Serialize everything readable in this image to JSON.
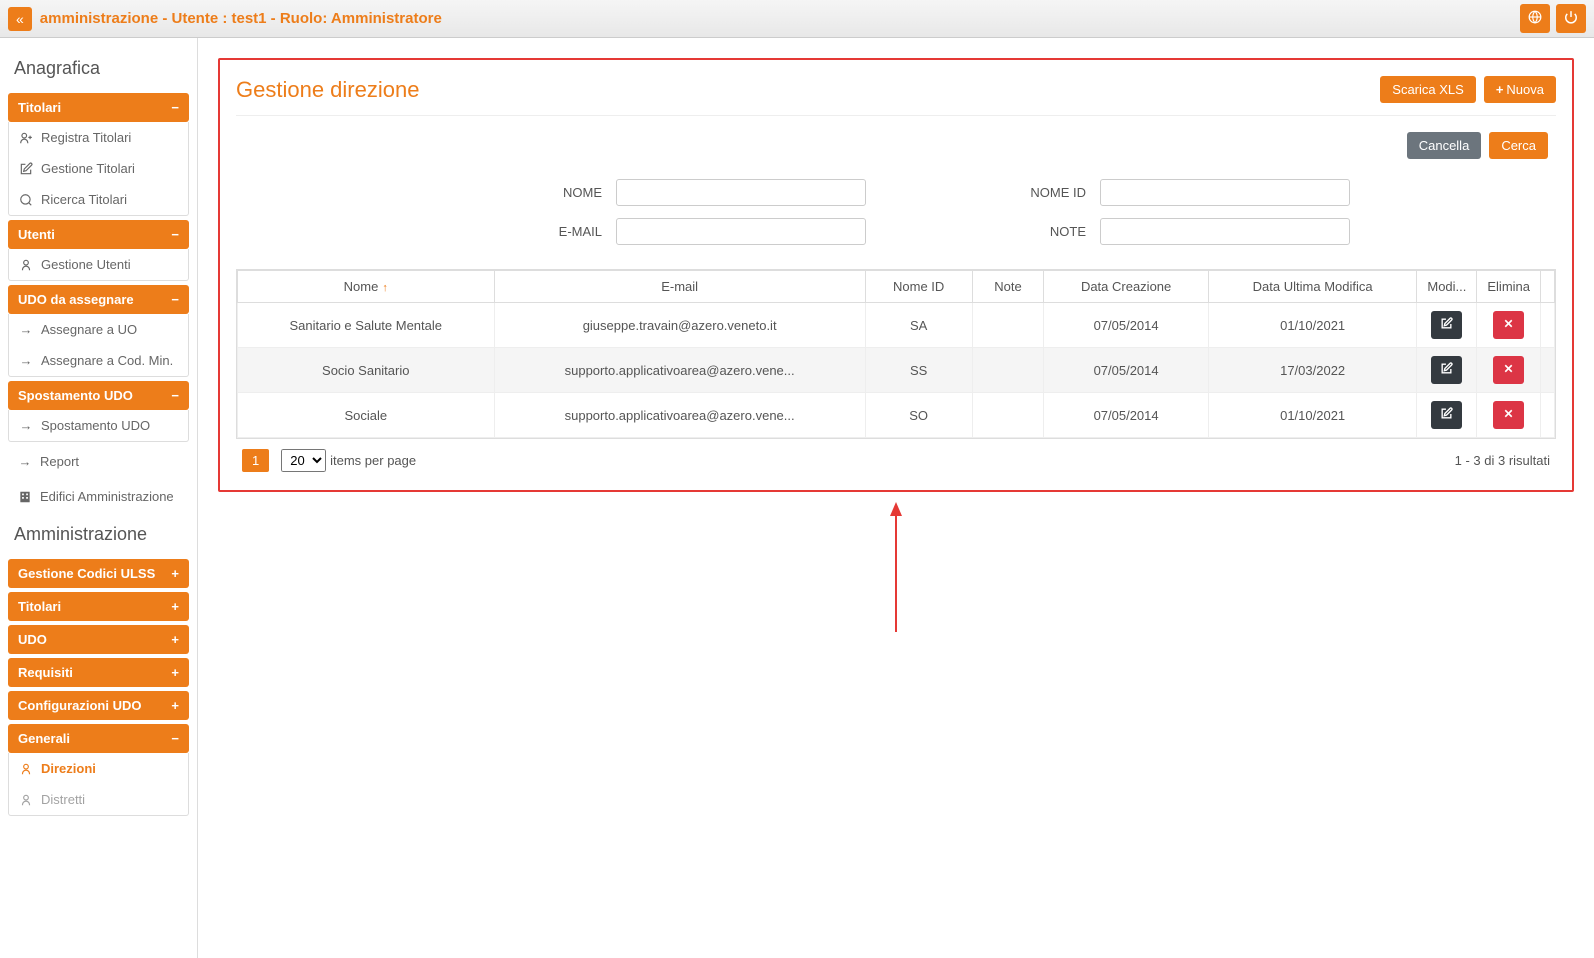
{
  "topbar": {
    "title": "amministrazione - Utente : test1 - Ruolo: Amministratore"
  },
  "sidebar": {
    "sections": {
      "anagrafica_label": "Anagrafica",
      "amministrazione_label": "Amministrazione"
    },
    "titolari": {
      "header": "Titolari",
      "items": [
        "Registra Titolari",
        "Gestione Titolari",
        "Ricerca Titolari"
      ]
    },
    "utenti": {
      "header": "Utenti",
      "items": [
        "Gestione Utenti"
      ]
    },
    "udo_assegnare": {
      "header": "UDO da assegnare",
      "items": [
        "Assegnare a UO",
        "Assegnare a Cod. Min."
      ]
    },
    "spostamento": {
      "header": "Spostamento UDO",
      "items": [
        "Spostamento UDO"
      ]
    },
    "flat_items": [
      "Report",
      "Edifici Amministrazione"
    ],
    "admin_headers": [
      "Gestione Codici ULSS",
      "Titolari",
      "UDO",
      "Requisiti",
      "Configurazioni UDO"
    ],
    "generali": {
      "header": "Generali",
      "items": [
        "Direzioni",
        "Distretti"
      ]
    }
  },
  "main": {
    "title": "Gestione direzione",
    "buttons": {
      "scarica_xls": "Scarica XLS",
      "nuova": "Nuova",
      "cancella": "Cancella",
      "cerca": "Cerca"
    },
    "search_labels": {
      "nome": "NOME",
      "email": "E-MAIL",
      "nome_id": "NOME ID",
      "note": "NOTE"
    },
    "table": {
      "headers": [
        "Nome",
        "E-mail",
        "Nome ID",
        "Note",
        "Data Creazione",
        "Data Ultima Modifica",
        "Modi...",
        "Elimina"
      ],
      "rows": [
        {
          "nome": "Sanitario e Salute Mentale",
          "email": "giuseppe.travain@azero.veneto.it",
          "nome_id": "SA",
          "note": "",
          "created": "07/05/2014",
          "modified": "01/10/2021"
        },
        {
          "nome": "Socio Sanitario",
          "email": "supporto.applicativoarea@azero.vene...",
          "nome_id": "SS",
          "note": "",
          "created": "07/05/2014",
          "modified": "17/03/2022"
        },
        {
          "nome": "Sociale",
          "email": "supporto.applicativoarea@azero.vene...",
          "nome_id": "SO",
          "note": "",
          "created": "07/05/2014",
          "modified": "01/10/2021"
        }
      ]
    },
    "pagination": {
      "current_page": "1",
      "page_size": "20",
      "items_label": "items per page",
      "results_info": "1 - 3 di 3 risultati"
    }
  }
}
